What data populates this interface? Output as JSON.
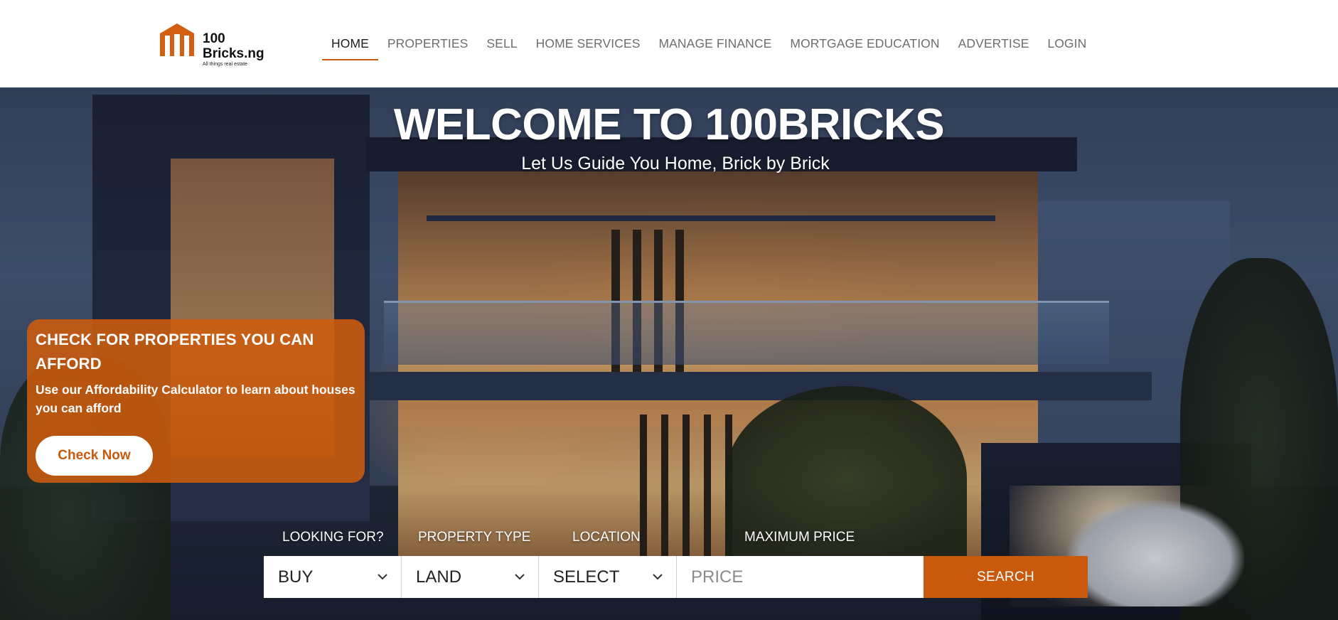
{
  "logo": {
    "line1": "100",
    "line2": "Bricks.ng",
    "tagline": "All things real estate",
    "color": "#d35f12"
  },
  "nav": {
    "items": [
      {
        "label": "HOME",
        "active": true
      },
      {
        "label": "PROPERTIES"
      },
      {
        "label": "SELL"
      },
      {
        "label": "HOME SERVICES"
      },
      {
        "label": "MANAGE FINANCE"
      },
      {
        "label": "MORTGAGE EDUCATION"
      },
      {
        "label": "ADVERTISE"
      },
      {
        "label": "LOGIN"
      }
    ]
  },
  "hero": {
    "title": "WELCOME TO 100BRICKS",
    "subtitle": "Let Us Guide You Home, Brick by Brick"
  },
  "afford": {
    "title": "CHECK FOR PROPERTIES YOU CAN AFFORD",
    "description": "Use our Affordability Calculator to learn about houses you can afford",
    "button_label": "Check Now"
  },
  "search": {
    "labels": {
      "looking_for": "LOOKING FOR?",
      "property_type": "PROPERTY TYPE",
      "location": "LOCATION",
      "max_price": "MAXIMUM PRICE"
    },
    "values": {
      "looking_for": "BUY",
      "property_type": "LAND",
      "location": "SELECT"
    },
    "price_placeholder": "PRICE",
    "button_label": "SEARCH"
  },
  "colors": {
    "accent": "#c9590c",
    "header_bg": "#ffffff",
    "nav_text": "#6d6d6d"
  }
}
